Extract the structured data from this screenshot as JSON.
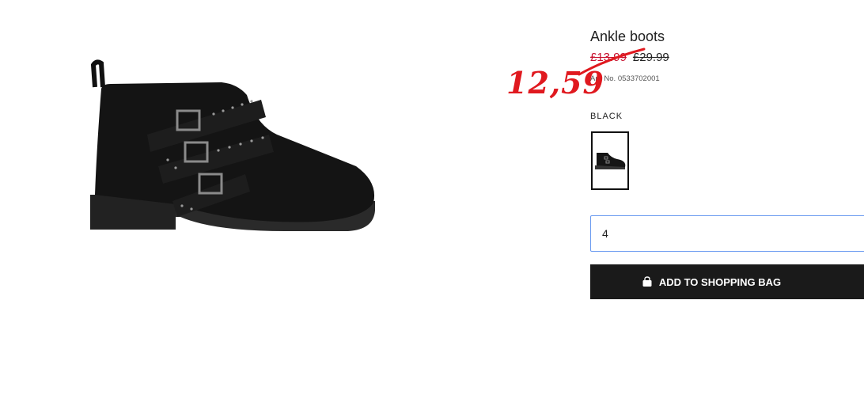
{
  "product": {
    "title": "Ankle boots",
    "sale_price": "£13.99",
    "original_price": "£29.99",
    "article_number": "Art. No. 0533702001",
    "annotation_price": "12,59"
  },
  "color": {
    "label": "BLACK"
  },
  "quantity": {
    "value": "4"
  },
  "cta": {
    "label": "ADD TO SHOPPING BAG"
  },
  "icons": {
    "bag": "shopping-bag-icon"
  },
  "colors": {
    "sale_red": "#c8102e",
    "annotation_red": "#e0191f",
    "input_border": "#6b9bf0",
    "button_bg": "#1a1a1a"
  }
}
